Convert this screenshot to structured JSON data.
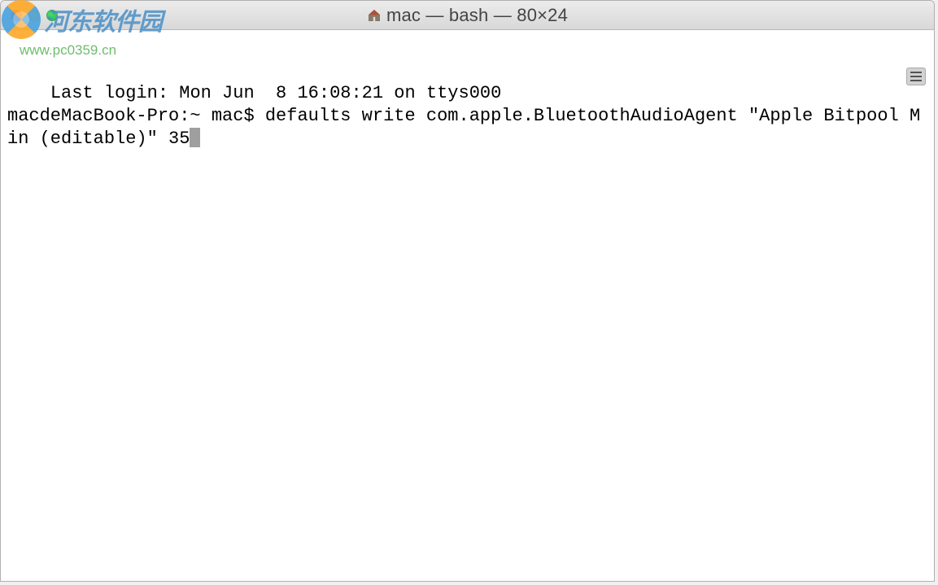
{
  "watermark": {
    "text": "河东软件园",
    "url": "www.pc0359.cn"
  },
  "window": {
    "title": "mac — bash — 80×24"
  },
  "terminal": {
    "line1": "Last login: Mon Jun  8 16:08:21 on ttys000",
    "prompt": "macdeMacBook-Pro:~ mac$ ",
    "command": "defaults write com.apple.BluetoothAudioAgent \"Apple Bitpool Min (editable)\" 35"
  }
}
